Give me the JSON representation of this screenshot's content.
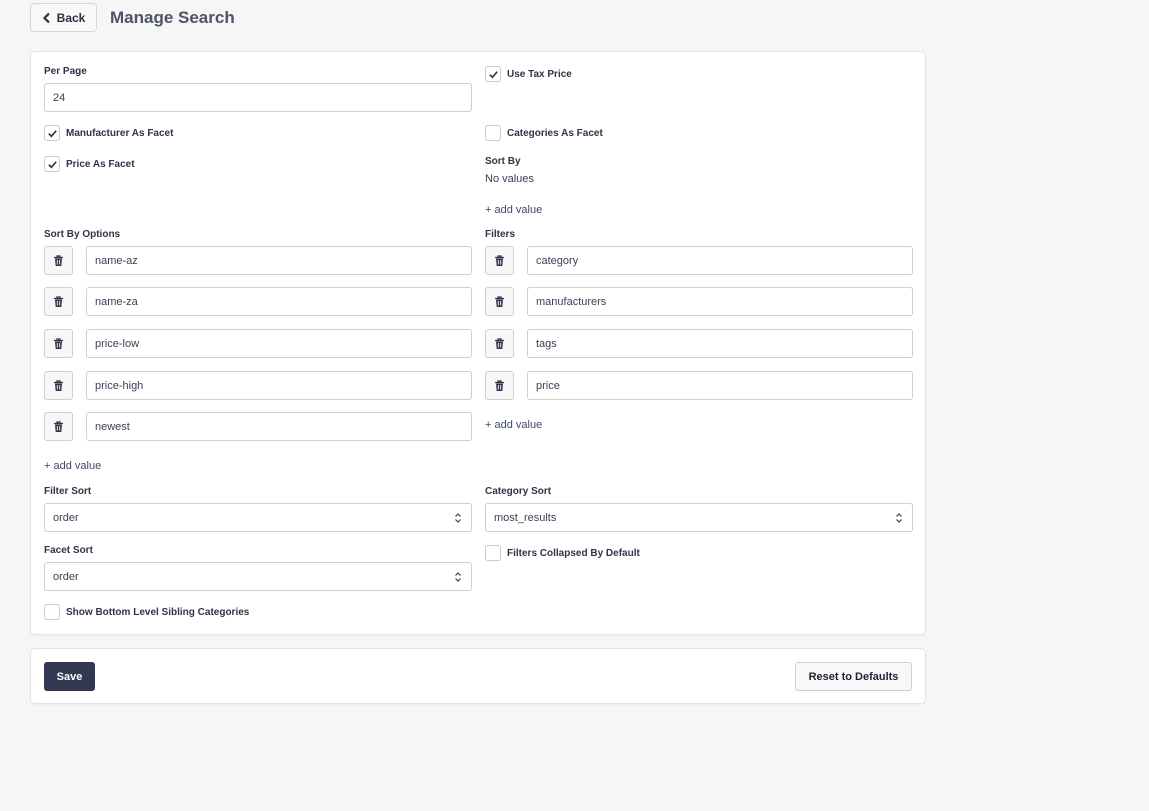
{
  "header": {
    "back_label": "Back",
    "title": "Manage Search"
  },
  "form": {
    "per_page": {
      "label": "Per Page",
      "value": "24"
    },
    "use_tax_price": {
      "label": "Use Tax Price",
      "checked": true
    },
    "manufacturer_as_facet": {
      "label": "Manufacturer As Facet",
      "checked": true
    },
    "categories_as_facet": {
      "label": "Categories As Facet",
      "checked": false
    },
    "price_as_facet": {
      "label": "Price As Facet",
      "checked": true
    },
    "sort_by": {
      "label": "Sort By",
      "empty_text": "No values",
      "add_label": "+ add value"
    },
    "sort_by_options": {
      "label": "Sort By Options",
      "values": [
        "name-az",
        "name-za",
        "price-low",
        "price-high",
        "newest"
      ],
      "add_label": "+ add value"
    },
    "filters": {
      "label": "Filters",
      "values": [
        "category",
        "manufacturers",
        "tags",
        "price"
      ],
      "add_label": "+ add value"
    },
    "filter_sort": {
      "label": "Filter Sort",
      "value": "order"
    },
    "category_sort": {
      "label": "Category Sort",
      "value": "most_results"
    },
    "facet_sort": {
      "label": "Facet Sort",
      "value": "order"
    },
    "filters_collapsed": {
      "label": "Filters Collapsed By Default",
      "checked": false
    },
    "show_bottom_level": {
      "label": "Show Bottom Level Sibling Categories",
      "checked": false
    }
  },
  "footer": {
    "save_label": "Save",
    "reset_label": "Reset to Defaults"
  },
  "icons": {
    "back": "chevron-left-icon",
    "check": "check-icon",
    "trash": "trash-icon",
    "select": "updown-chevron-icon"
  },
  "colors": {
    "primary": "#323752",
    "background": "#f6f6f6",
    "card": "#ffffff"
  }
}
